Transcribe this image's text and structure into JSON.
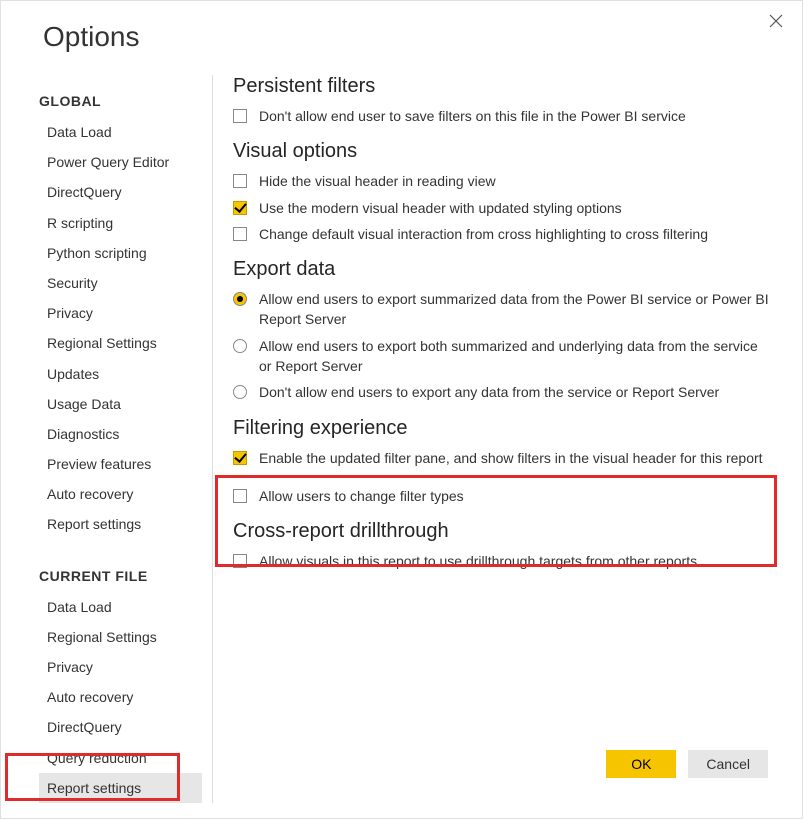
{
  "dialog_title": "Options",
  "sidebar": {
    "global_title": "GLOBAL",
    "current_file_title": "CURRENT FILE",
    "global_items": [
      "Data Load",
      "Power Query Editor",
      "DirectQuery",
      "R scripting",
      "Python scripting",
      "Security",
      "Privacy",
      "Regional Settings",
      "Updates",
      "Usage Data",
      "Diagnostics",
      "Preview features",
      "Auto recovery",
      "Report settings"
    ],
    "current_file_items": [
      "Data Load",
      "Regional Settings",
      "Privacy",
      "Auto recovery",
      "DirectQuery",
      "Query reduction",
      "Report settings"
    ],
    "selected_current_file_index": 6
  },
  "sections": {
    "persistent_filters": {
      "heading": "Persistent filters",
      "opt0": "Don't allow end user to save filters on this file in the Power BI service"
    },
    "visual_options": {
      "heading": "Visual options",
      "opt0": "Hide the visual header in reading view",
      "opt1": "Use the modern visual header with updated styling options",
      "opt2": "Change default visual interaction from cross highlighting to cross filtering"
    },
    "export_data": {
      "heading": "Export data",
      "opt0": "Allow end users to export summarized data from the Power BI service or Power BI Report Server",
      "opt1": "Allow end users to export both summarized and underlying data from the service or Report Server",
      "opt2": "Don't allow end users to export any data from the service or Report Server"
    },
    "filtering_experience": {
      "heading": "Filtering experience",
      "opt0": "Enable the updated filter pane, and show filters in the visual header for this report",
      "opt1": "Allow users to change filter types"
    },
    "cross_report": {
      "heading": "Cross-report drillthrough",
      "opt0": "Allow visuals in this report to use drillthrough targets from other reports"
    }
  },
  "buttons": {
    "ok": "OK",
    "cancel": "Cancel"
  }
}
